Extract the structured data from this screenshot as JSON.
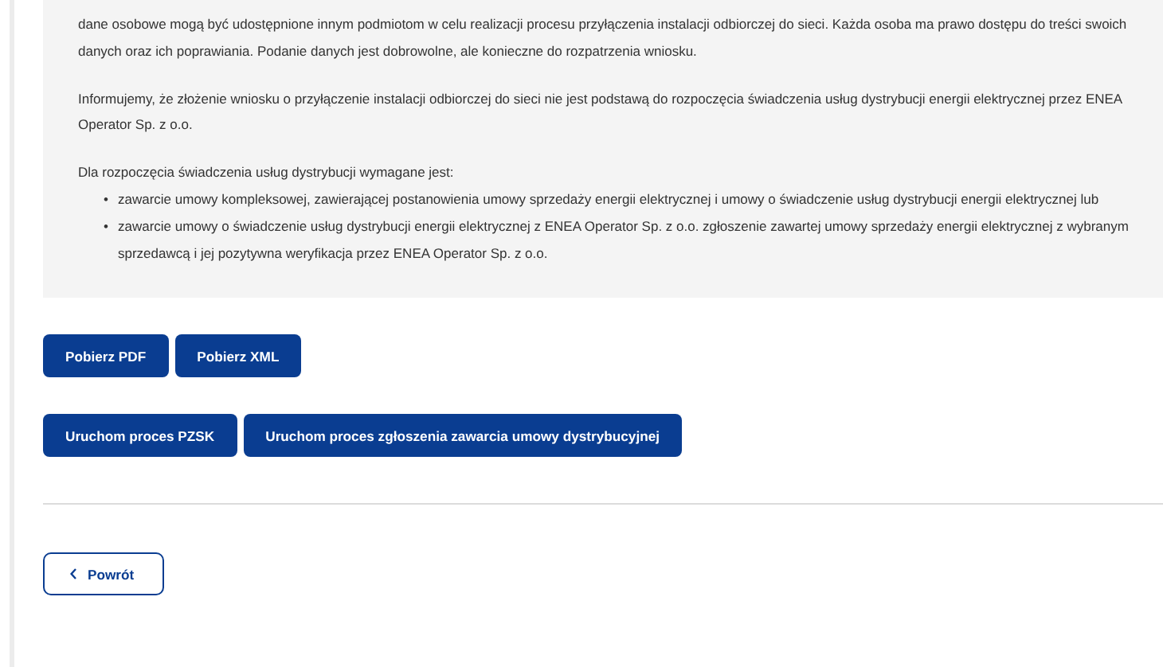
{
  "info_panel": {
    "blocks": [
      {
        "kind": "paragraph",
        "text": "dane osobowe mogą być udostępnione innym podmiotom w celu realizacji procesu przyłączenia instalacji odbiorczej do sieci. Każda osoba ma prawo dostępu do treści swoich danych oraz ich poprawiania. Podanie danych jest dobrowolne, ale konieczne do rozpatrzenia wniosku."
      },
      {
        "kind": "paragraph",
        "text": "Informujemy, że złożenie wniosku o przyłączenie instalacji odbiorczej do sieci nie jest podstawą do rozpoczęcia świadczenia usług dystrybucji energii elektrycznej przez ENEA Operator Sp. z o.o."
      },
      {
        "kind": "list",
        "intro": "Dla rozpoczęcia świadczenia usług dystrybucji wymagane jest:",
        "items": [
          {
            "marker": "•",
            "text": "zawarcie umowy kompleksowej, zawierającej postanowienia umowy sprzedaży energii elektrycznej i umowy o świadczenie usług dystrybucji energii elektrycznej lub"
          },
          {
            "marker": "•",
            "text": "zawarcie umowy o świadczenie usług dystrybucji energii elektrycznej z ENEA Operator Sp. z o.o. zgłoszenie zawartej umowy sprzedaży energii elektrycznej z wybranym sprzedawcą i jej pozytywna weryfikacja przez ENEA Operator Sp. z o.o."
          }
        ]
      }
    ]
  },
  "button_rows": [
    [
      "Pobierz PDF",
      "Pobierz XML"
    ],
    [
      "Uruchom proces PZSK",
      "Uruchom proces zgłoszenia zawarcia umowy dystrybucyjnej"
    ]
  ],
  "back_button": "Powrót"
}
